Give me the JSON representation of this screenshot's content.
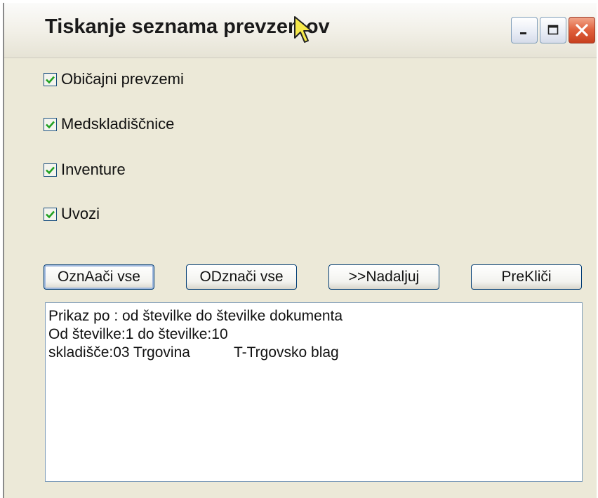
{
  "window": {
    "title": "Tiskanje seznama prevzemov"
  },
  "checkboxes": [
    {
      "label": "Običajni prevzemi",
      "checked": true
    },
    {
      "label": "Medskladiščnice",
      "checked": true
    },
    {
      "label": "Inventure",
      "checked": true
    },
    {
      "label": "Uvozi",
      "checked": true
    }
  ],
  "buttons": {
    "select_all": "OznAači vse",
    "deselect_all": "ODznači vse",
    "continue": ">>Nadaljuj",
    "cancel": "PreKliči"
  },
  "listbox": {
    "line1": "Prikaz po : od številke do številke dokumenta",
    "line2": "Od številke:1 do številke:10",
    "line3_left": "skladišče:03 Trgovina",
    "line3_right": "T-Trgovsko blag"
  },
  "colors": {
    "window_bg": "#ece9d8",
    "checkbox_check": "#21a121",
    "button_border": "#003c74",
    "close_button": "#e0603c"
  },
  "icons": {
    "minimize": "minimize-icon",
    "maximize": "maximize-icon",
    "close": "close-icon",
    "cursor": "mouse-cursor-icon",
    "check": "checkmark-icon"
  }
}
